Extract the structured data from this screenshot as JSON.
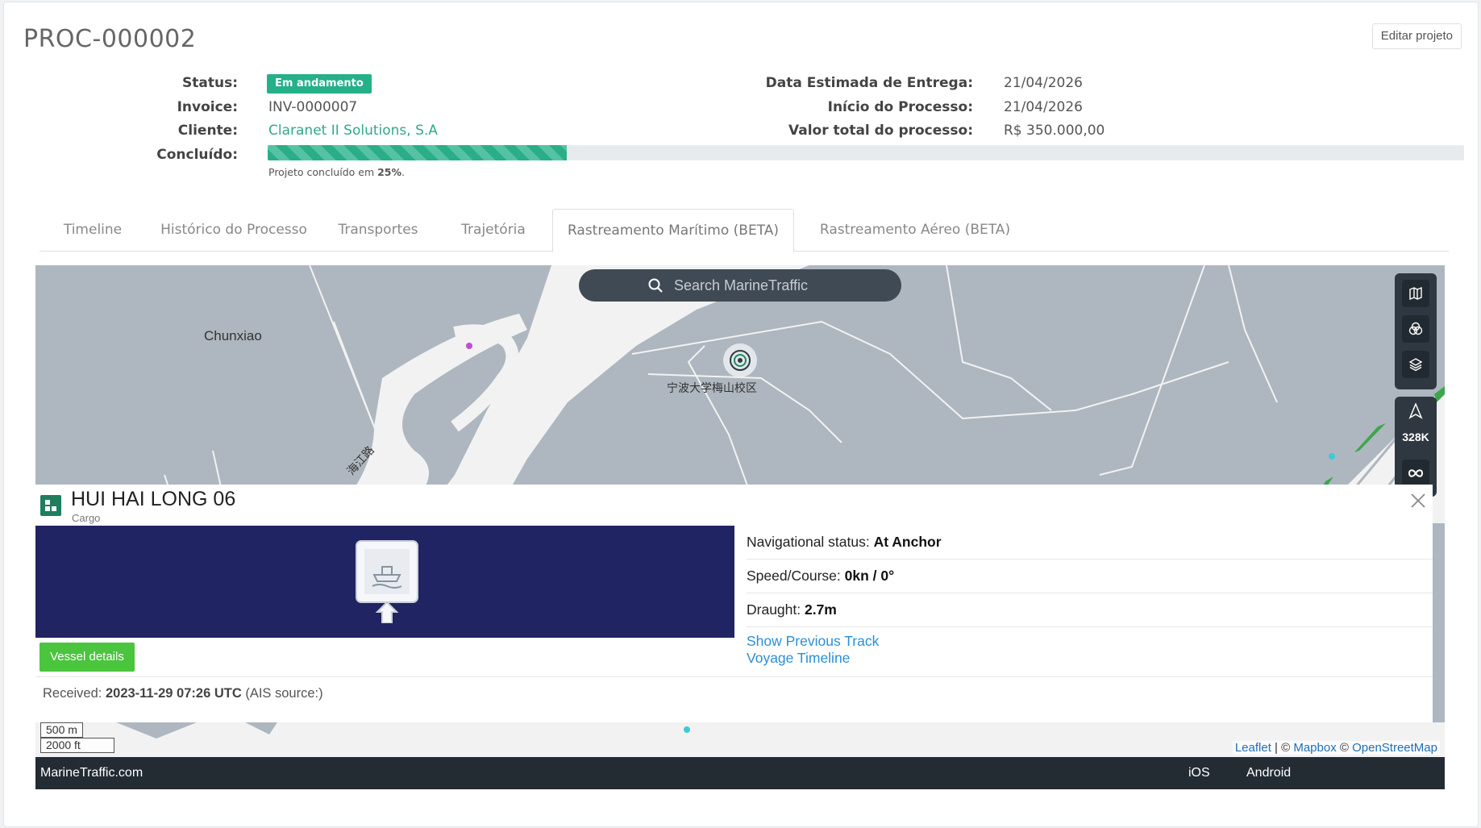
{
  "header": {
    "title": "PROC-000002",
    "edit_button": "Editar projeto"
  },
  "details": {
    "status_label": "Status:",
    "status_value": "Em andamento",
    "invoice_label": "Invoice:",
    "invoice_value": "INV-0000007",
    "cliente_label": "Cliente:",
    "cliente_value": "Claranet II Solutions, S.A",
    "concluido_label": "Concluído:",
    "progress_percent": 25,
    "progress_caption_prefix": "Projeto concluído em ",
    "progress_caption_value": "25%",
    "entrega_label": "Data Estimada de Entrega:",
    "entrega_value": "21/04/2026",
    "inicio_label": "Início do Processo:",
    "inicio_value": "21/04/2026",
    "valor_label": "Valor total do processo:",
    "valor_value": "R$ 350.000,00"
  },
  "tabs": [
    {
      "label": "Timeline",
      "active": false
    },
    {
      "label": "Histórico do Processo",
      "active": false
    },
    {
      "label": "Transportes",
      "active": false
    },
    {
      "label": "Trajetória",
      "active": false
    },
    {
      "label": "Rastreamento Marítimo (BETA)",
      "active": true
    },
    {
      "label": "Rastreamento Aéreo (BETA)",
      "active": false
    }
  ],
  "map": {
    "search_placeholder": "Search MarineTraffic",
    "place_chunxiao": "Chunxiao",
    "place_campus": "宁波大学梅山校区",
    "road_label": "海江路",
    "zoom_readout": "328K",
    "scale_m": "500 m",
    "scale_ft": "2000 ft",
    "attribution_leaflet": "Leaflet",
    "attribution_sep1": " | © ",
    "attribution_mapbox": "Mapbox",
    "attribution_sep2": " © ",
    "attribution_osm": "OpenStreetMap"
  },
  "vessel": {
    "name": "HUI HAI LONG 06",
    "type": "Cargo",
    "nav_status_label": "Navigational status: ",
    "nav_status_value": "At Anchor",
    "speed_label": "Speed/Course: ",
    "speed_value": "0kn / 0°",
    "draught_label": "Draught: ",
    "draught_value": "2.7m",
    "show_track": "Show Previous Track",
    "voyage_timeline": "Voyage Timeline",
    "details_button": "Vessel details",
    "received_label": "Received: ",
    "received_value": "2023-11-29 07:26 UTC",
    "received_suffix": " (AIS source:)"
  },
  "footer": {
    "brand": "MarineTraffic.com",
    "ios": "iOS",
    "android": "Android"
  },
  "colors": {
    "accent": "#26b08a",
    "link": "#2a8fd6",
    "map_land": "#aeb7bf",
    "map_water": "#f2f2f2",
    "footer_bg": "#232b33",
    "vessel_btn": "#4bc43e"
  }
}
